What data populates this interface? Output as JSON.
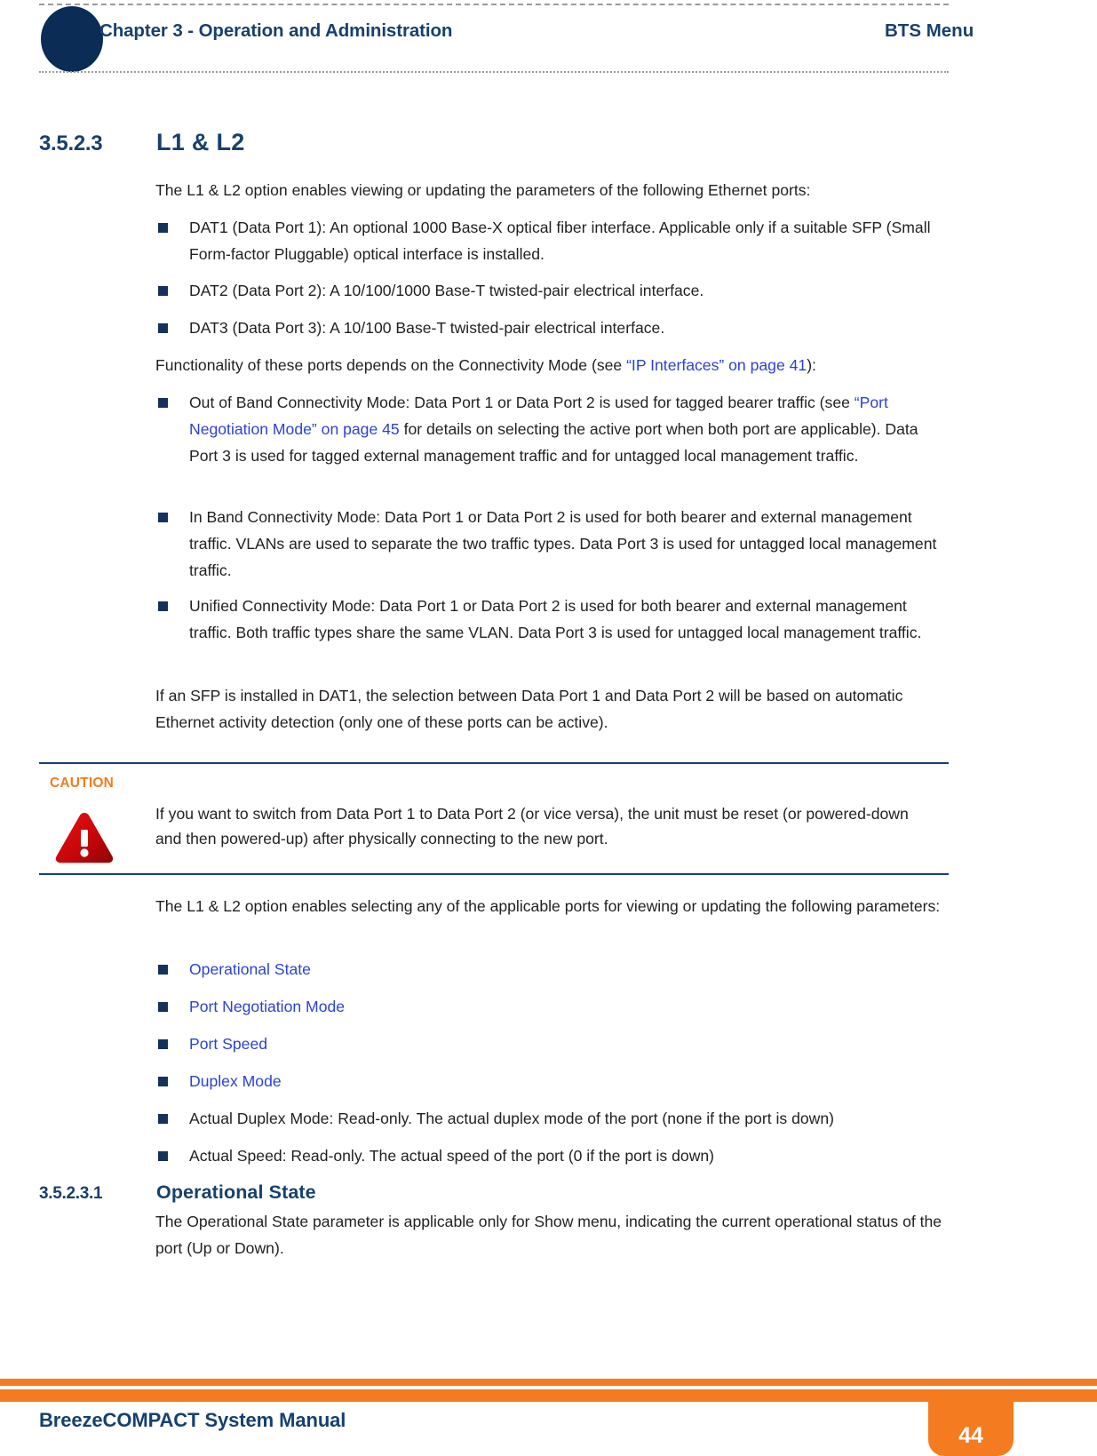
{
  "header": {
    "chapter": "Chapter 3 - Operation and Administration",
    "section": "BTS Menu",
    "dot_icon": "navy-circle-icon"
  },
  "section": {
    "number": "3.5.2.3",
    "title": "L1 & L2"
  },
  "intro_paragraph": "The L1 & L2 option enables viewing or updating the parameters of the following Ethernet ports:",
  "port_bullets": [
    "DAT1 (Data Port 1): An optional 1000 Base-X optical fiber interface. Applicable only if a suitable SFP (Small Form-factor Pluggable) optical interface is installed.",
    "DAT2 (Data Port 2): A 10/100/1000 Base-T twisted-pair electrical interface.",
    "DAT3 (Data Port 3): A 10/100 Base-T twisted-pair electrical interface."
  ],
  "functionality_paragraph": {
    "before_link": "Functionality of these ports depends on the Connectivity Mode (see ",
    "link": "“IP Interfaces” on page 41",
    "after_link": "):"
  },
  "mode_bullets": [
    {
      "before_link": "Out of Band Connectivity Mode: Data Port 1 or Data Port 2 is used for tagged bearer traffic (see ",
      "link": "“Port Negotiation Mode” on page 45",
      "after_link": " for details on selecting the active port when both port are applicable). Data Port 3 is used for tagged external management traffic and for untagged local management traffic."
    },
    {
      "before_link": "In Band Connectivity Mode: Data Port 1 or Data Port 2 is used for both bearer and external management traffic. VLANs are used to separate the two traffic types. Data Port 3 is used for untagged local management traffic.",
      "link": "",
      "after_link": ""
    },
    {
      "before_link": "Unified Connectivity Mode: Data Port 1 or Data Port 2 is used for both bearer and external management traffic. Both traffic types share the same VLAN. Data Port 3 is used for untagged local management traffic.",
      "link": "",
      "after_link": ""
    }
  ],
  "sfp_paragraph": "If an SFP is installed in DAT1, the selection between Data Port 1 and Data Port 2 will be based on automatic Ethernet activity detection (only one of these ports can be active).",
  "caution": {
    "label": "CAUTION",
    "icon": "warning-triangle-icon",
    "text": "If you want to switch from Data Port 1 to Data Port 2 (or vice versa), the unit must be reset (or powered-down and then powered-up) after physically connecting to the new port."
  },
  "params_paragraph": "The L1 & L2 option enables selecting any of the applicable ports for viewing or updating the following parameters:",
  "param_bullets": [
    {
      "text": "Operational State",
      "is_link": true
    },
    {
      "text": "Port Negotiation Mode",
      "is_link": true
    },
    {
      "text": "Port Speed",
      "is_link": true
    },
    {
      "text": "Duplex Mode",
      "is_link": true
    },
    {
      "text": "Actual Duplex Mode: Read-only. The actual duplex mode of the port (none if the port is down)",
      "is_link": false
    },
    {
      "text": "Actual Speed: Read-only. The actual speed of the port (0 if the port is down)",
      "is_link": false
    }
  ],
  "subsection": {
    "number": "3.5.2.3.1",
    "title": "Operational State",
    "paragraph": "The Operational State parameter is applicable only for Show menu, indicating the current operational status of the port (Up or Down)."
  },
  "footer": {
    "title": "BreezeCOMPACT System Manual",
    "page_number": "44"
  },
  "colors": {
    "navy": "#17406d",
    "dark_navy": "#0a2c55",
    "orange": "#f47b20",
    "link_blue": "#2b42d6",
    "bullet": "#16315c",
    "caution_red": "#d81212"
  }
}
